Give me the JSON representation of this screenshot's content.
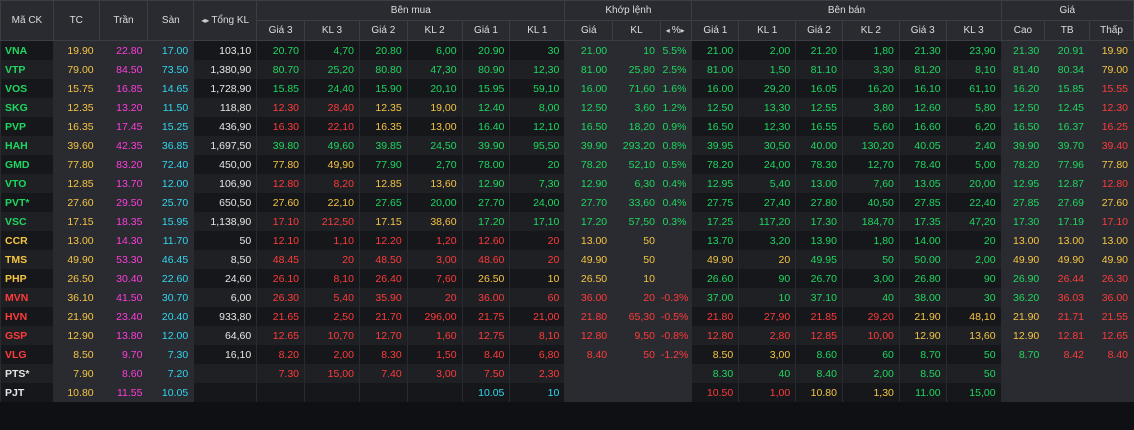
{
  "colors": {
    "green": "#1ed760",
    "red": "#ff3b3b",
    "yellow": "#f5c542",
    "purple": "#ff3ddb",
    "cyan": "#2ed8ef",
    "white": "#e6e6e6"
  },
  "header": {
    "ma_ck": "Mã CK",
    "tc": "TC",
    "tran": "Trần",
    "san": "Sàn",
    "tong_kl": "Tổng KL",
    "ben_mua": "Bên mua",
    "khop_lenh": "Khớp lệnh",
    "ben_ban": "Bên bán",
    "gia": "Giá",
    "gia3": "Giá 3",
    "kl3": "KL 3",
    "gia2": "Giá 2",
    "kl2": "KL 2",
    "gia1": "Giá 1",
    "kl1": "KL 1",
    "khop_gia": "Giá",
    "khop_kl": "KL",
    "khop_pct": "%",
    "cao": "Cao",
    "tb": "TB",
    "thap": "Thấp"
  },
  "rows": [
    {
      "sym": "VNA",
      "sc": "g",
      "tc": "19.90",
      "tran": "22.80",
      "san": "17.00",
      "tkl": "103,10",
      "b3": "20.70",
      "b3c": "g",
      "bk3": "4,70",
      "b2": "20.80",
      "b2c": "g",
      "bk2": "6,00",
      "b1": "20.90",
      "b1c": "g",
      "bk1": "30",
      "mp": "21.00",
      "mc": "g",
      "mk": "10",
      "pct": "5.5%",
      "s1": "21.00",
      "s1c": "g",
      "sk1": "2,00",
      "s2": "21.20",
      "s2c": "g",
      "sk2": "1,80",
      "s3": "21.30",
      "s3c": "g",
      "sk3": "23,90",
      "hi": "21.30",
      "hic": "g",
      "avg": "20.91",
      "avgc": "g",
      "lo": "19.90",
      "loc": "y"
    },
    {
      "sym": "VTP",
      "sc": "g",
      "tc": "79.00",
      "tran": "84.50",
      "san": "73.50",
      "tkl": "1,380,90",
      "b3": "80.70",
      "b3c": "g",
      "bk3": "25,20",
      "b2": "80.80",
      "b2c": "g",
      "bk2": "47,30",
      "b1": "80.90",
      "b1c": "g",
      "bk1": "12,30",
      "mp": "81.00",
      "mc": "g",
      "mk": "25,80",
      "pct": "2.5%",
      "s1": "81.00",
      "s1c": "g",
      "sk1": "1,50",
      "s2": "81.10",
      "s2c": "g",
      "sk2": "3,30",
      "s3": "81.20",
      "s3c": "g",
      "sk3": "8,10",
      "hi": "81.40",
      "hic": "g",
      "avg": "80.34",
      "avgc": "g",
      "lo": "79.00",
      "loc": "y"
    },
    {
      "sym": "VOS",
      "sc": "g",
      "tc": "15.75",
      "tran": "16.85",
      "san": "14.65",
      "tkl": "1,728,90",
      "b3": "15.85",
      "b3c": "g",
      "bk3": "24,40",
      "b2": "15.90",
      "b2c": "g",
      "bk2": "20,10",
      "b1": "15.95",
      "b1c": "g",
      "bk1": "59,10",
      "mp": "16.00",
      "mc": "g",
      "mk": "71,60",
      "pct": "1.6%",
      "s1": "16.00",
      "s1c": "g",
      "sk1": "29,20",
      "s2": "16.05",
      "s2c": "g",
      "sk2": "16,20",
      "s3": "16.10",
      "s3c": "g",
      "sk3": "61,10",
      "hi": "16.20",
      "hic": "g",
      "avg": "15.85",
      "avgc": "g",
      "lo": "15.55",
      "loc": "r"
    },
    {
      "sym": "SKG",
      "sc": "g",
      "tc": "12.35",
      "tran": "13.20",
      "san": "11.50",
      "tkl": "118,80",
      "b3": "12.30",
      "b3c": "r",
      "bk3": "28,40",
      "b2": "12.35",
      "b2c": "y",
      "bk2": "19,00",
      "b1": "12.40",
      "b1c": "g",
      "bk1": "8,00",
      "mp": "12.50",
      "mc": "g",
      "mk": "3,60",
      "pct": "1.2%",
      "s1": "12.50",
      "s1c": "g",
      "sk1": "13,30",
      "s2": "12.55",
      "s2c": "g",
      "sk2": "3,80",
      "s3": "12.60",
      "s3c": "g",
      "sk3": "5,80",
      "hi": "12.50",
      "hic": "g",
      "avg": "12.45",
      "avgc": "g",
      "lo": "12.30",
      "loc": "r"
    },
    {
      "sym": "PVP",
      "sc": "g",
      "tc": "16.35",
      "tran": "17.45",
      "san": "15.25",
      "tkl": "436,90",
      "b3": "16.30",
      "b3c": "r",
      "bk3": "22,10",
      "b2": "16.35",
      "b2c": "y",
      "bk2": "13,00",
      "b1": "16.40",
      "b1c": "g",
      "bk1": "12,10",
      "mp": "16.50",
      "mc": "g",
      "mk": "18,20",
      "pct": "0.9%",
      "s1": "16.50",
      "s1c": "g",
      "sk1": "12,30",
      "s2": "16.55",
      "s2c": "g",
      "sk2": "5,60",
      "s3": "16.60",
      "s3c": "g",
      "sk3": "6,20",
      "hi": "16.50",
      "hic": "g",
      "avg": "16.37",
      "avgc": "g",
      "lo": "16.25",
      "loc": "r"
    },
    {
      "sym": "HAH",
      "sc": "g",
      "tc": "39.60",
      "tran": "42.35",
      "san": "36.85",
      "tkl": "1,697,50",
      "b3": "39.80",
      "b3c": "g",
      "bk3": "49,60",
      "b2": "39.85",
      "b2c": "g",
      "bk2": "24,50",
      "b1": "39.90",
      "b1c": "g",
      "bk1": "95,50",
      "mp": "39.90",
      "mc": "g",
      "mk": "293,20",
      "pct": "0.8%",
      "s1": "39.95",
      "s1c": "g",
      "sk1": "30,50",
      "s2": "40.00",
      "s2c": "g",
      "sk2": "130,20",
      "s3": "40.05",
      "s3c": "g",
      "sk3": "2,40",
      "hi": "39.90",
      "hic": "g",
      "avg": "39.70",
      "avgc": "g",
      "lo": "39.40",
      "loc": "r"
    },
    {
      "sym": "GMD",
      "sc": "g",
      "tc": "77.80",
      "tran": "83.20",
      "san": "72.40",
      "tkl": "450,00",
      "b3": "77.80",
      "b3c": "y",
      "bk3": "49,90",
      "b2": "77.90",
      "b2c": "g",
      "bk2": "2,70",
      "b1": "78.00",
      "b1c": "g",
      "bk1": "20",
      "mp": "78.20",
      "mc": "g",
      "mk": "52,10",
      "pct": "0.5%",
      "s1": "78.20",
      "s1c": "g",
      "sk1": "24,00",
      "s2": "78.30",
      "s2c": "g",
      "sk2": "12,70",
      "s3": "78.40",
      "s3c": "g",
      "sk3": "5,00",
      "hi": "78.20",
      "hic": "g",
      "avg": "77.96",
      "avgc": "g",
      "lo": "77.80",
      "loc": "y"
    },
    {
      "sym": "VTO",
      "sc": "g",
      "tc": "12.85",
      "tran": "13.70",
      "san": "12.00",
      "tkl": "106,90",
      "b3": "12.80",
      "b3c": "r",
      "bk3": "8,20",
      "b2": "12.85",
      "b2c": "y",
      "bk2": "13,60",
      "b1": "12.90",
      "b1c": "g",
      "bk1": "7,30",
      "mp": "12.90",
      "mc": "g",
      "mk": "6,30",
      "pct": "0.4%",
      "s1": "12.95",
      "s1c": "g",
      "sk1": "5,40",
      "s2": "13.00",
      "s2c": "g",
      "sk2": "7,60",
      "s3": "13.05",
      "s3c": "g",
      "sk3": "20,00",
      "hi": "12.95",
      "hic": "g",
      "avg": "12.87",
      "avgc": "g",
      "lo": "12.80",
      "loc": "r"
    },
    {
      "sym": "PVT*",
      "sc": "g",
      "tc": "27.60",
      "tran": "29.50",
      "san": "25.70",
      "tkl": "650,50",
      "b3": "27.60",
      "b3c": "y",
      "bk3": "22,10",
      "b2": "27.65",
      "b2c": "g",
      "bk2": "20,00",
      "b1": "27.70",
      "b1c": "g",
      "bk1": "24,00",
      "mp": "27.70",
      "mc": "g",
      "mk": "33,60",
      "pct": "0.4%",
      "s1": "27.75",
      "s1c": "g",
      "sk1": "27,40",
      "s2": "27.80",
      "s2c": "g",
      "sk2": "40,50",
      "s3": "27.85",
      "s3c": "g",
      "sk3": "22,40",
      "hi": "27.85",
      "hic": "g",
      "avg": "27.69",
      "avgc": "g",
      "lo": "27.60",
      "loc": "y"
    },
    {
      "sym": "VSC",
      "sc": "g",
      "tc": "17.15",
      "tran": "18.35",
      "san": "15.95",
      "tkl": "1,138,90",
      "b3": "17.10",
      "b3c": "r",
      "bk3": "212,50",
      "b2": "17.15",
      "b2c": "y",
      "bk2": "38,60",
      "b1": "17.20",
      "b1c": "g",
      "bk1": "17,10",
      "mp": "17.20",
      "mc": "g",
      "mk": "57,50",
      "pct": "0.3%",
      "s1": "17.25",
      "s1c": "g",
      "sk1": "117,20",
      "s2": "17.30",
      "s2c": "g",
      "sk2": "184,70",
      "s3": "17.35",
      "s3c": "g",
      "sk3": "47,20",
      "hi": "17.30",
      "hic": "g",
      "avg": "17.19",
      "avgc": "g",
      "lo": "17.10",
      "loc": "r"
    },
    {
      "sym": "CCR",
      "sc": "y",
      "tc": "13.00",
      "tran": "14.30",
      "san": "11.70",
      "tkl": "50",
      "b3": "12.10",
      "b3c": "r",
      "bk3": "1,10",
      "b2": "12.20",
      "b2c": "r",
      "bk2": "1,20",
      "b1": "12.60",
      "b1c": "r",
      "bk1": "20",
      "mp": "13.00",
      "mc": "y",
      "mk": "50",
      "pct": "",
      "s1": "13.70",
      "s1c": "g",
      "sk1": "3,20",
      "s2": "13.90",
      "s2c": "g",
      "sk2": "1,80",
      "s3": "14.00",
      "s3c": "g",
      "sk3": "20",
      "hi": "13.00",
      "hic": "y",
      "avg": "13.00",
      "avgc": "y",
      "lo": "13.00",
      "loc": "y"
    },
    {
      "sym": "TMS",
      "sc": "y",
      "tc": "49.90",
      "tran": "53.30",
      "san": "46.45",
      "tkl": "8,50",
      "b3": "48.45",
      "b3c": "r",
      "bk3": "20",
      "b2": "48.50",
      "b2c": "r",
      "bk2": "3,00",
      "b1": "48.60",
      "b1c": "r",
      "bk1": "20",
      "mp": "49.90",
      "mc": "y",
      "mk": "50",
      "pct": "",
      "s1": "49.90",
      "s1c": "y",
      "sk1": "20",
      "s2": "49.95",
      "s2c": "g",
      "sk2": "50",
      "s3": "50.00",
      "s3c": "g",
      "sk3": "2,00",
      "hi": "49.90",
      "hic": "y",
      "avg": "49.90",
      "avgc": "y",
      "lo": "49.90",
      "loc": "y"
    },
    {
      "sym": "PHP",
      "sc": "y",
      "tc": "26.50",
      "tran": "30.40",
      "san": "22.60",
      "tkl": "24,60",
      "b3": "26.10",
      "b3c": "r",
      "bk3": "8,10",
      "b2": "26.40",
      "b2c": "r",
      "bk2": "7,60",
      "b1": "26.50",
      "b1c": "y",
      "bk1": "10",
      "mp": "26.50",
      "mc": "y",
      "mk": "10",
      "pct": "",
      "s1": "26.60",
      "s1c": "g",
      "sk1": "90",
      "s2": "26.70",
      "s2c": "g",
      "sk2": "3,00",
      "s3": "26.80",
      "s3c": "g",
      "sk3": "90",
      "hi": "26.90",
      "hic": "g",
      "avg": "26.44",
      "avgc": "r",
      "lo": "26.30",
      "loc": "r"
    },
    {
      "sym": "MVN",
      "sc": "r",
      "tc": "36.10",
      "tran": "41.50",
      "san": "30.70",
      "tkl": "6,00",
      "b3": "26.30",
      "b3c": "r",
      "bk3": "5,40",
      "b2": "35.90",
      "b2c": "r",
      "bk2": "20",
      "b1": "36.00",
      "b1c": "r",
      "bk1": "60",
      "mp": "36.00",
      "mc": "r",
      "mk": "20",
      "pct": "-0.3%",
      "s1": "37.00",
      "s1c": "g",
      "sk1": "10",
      "s2": "37.10",
      "s2c": "g",
      "sk2": "40",
      "s3": "38.00",
      "s3c": "g",
      "sk3": "30",
      "hi": "36.20",
      "hic": "g",
      "avg": "36.03",
      "avgc": "r",
      "lo": "36.00",
      "loc": "r"
    },
    {
      "sym": "HVN",
      "sc": "r",
      "tc": "21.90",
      "tran": "23.40",
      "san": "20.40",
      "tkl": "933,80",
      "b3": "21.65",
      "b3c": "r",
      "bk3": "2,50",
      "b2": "21.70",
      "b2c": "r",
      "bk2": "296,00",
      "b1": "21.75",
      "b1c": "r",
      "bk1": "21,00",
      "mp": "21.80",
      "mc": "r",
      "mk": "65,30",
      "pct": "-0.5%",
      "s1": "21.80",
      "s1c": "r",
      "sk1": "27,90",
      "s2": "21.85",
      "s2c": "r",
      "sk2": "29,20",
      "s3": "21.90",
      "s3c": "y",
      "sk3": "48,10",
      "hi": "21.90",
      "hic": "y",
      "avg": "21.71",
      "avgc": "r",
      "lo": "21.55",
      "loc": "r"
    },
    {
      "sym": "GSP",
      "sc": "r",
      "tc": "12.90",
      "tran": "13.80",
      "san": "12.00",
      "tkl": "64,60",
      "b3": "12.65",
      "b3c": "r",
      "bk3": "10,70",
      "b2": "12.70",
      "b2c": "r",
      "bk2": "1,60",
      "b1": "12.75",
      "b1c": "r",
      "bk1": "8,10",
      "mp": "12.80",
      "mc": "r",
      "mk": "9,50",
      "pct": "-0.8%",
      "s1": "12.80",
      "s1c": "r",
      "sk1": "2,80",
      "s2": "12.85",
      "s2c": "r",
      "sk2": "10,00",
      "s3": "12.90",
      "s3c": "y",
      "sk3": "13,60",
      "hi": "12.90",
      "hic": "y",
      "avg": "12.81",
      "avgc": "r",
      "lo": "12.65",
      "loc": "r"
    },
    {
      "sym": "VLG",
      "sc": "r",
      "tc": "8.50",
      "tran": "9.70",
      "san": "7.30",
      "tkl": "16,10",
      "b3": "8.20",
      "b3c": "r",
      "bk3": "2,00",
      "b2": "8.30",
      "b2c": "r",
      "bk2": "1,50",
      "b1": "8.40",
      "b1c": "r",
      "bk1": "6,80",
      "mp": "8.40",
      "mc": "r",
      "mk": "50",
      "pct": "-1.2%",
      "s1": "8.50",
      "s1c": "y",
      "sk1": "3,00",
      "s2": "8.60",
      "s2c": "g",
      "sk2": "60",
      "s3": "8.70",
      "s3c": "g",
      "sk3": "50",
      "hi": "8.70",
      "hic": "g",
      "avg": "8.42",
      "avgc": "r",
      "lo": "8.40",
      "loc": "r"
    },
    {
      "sym": "PTS*",
      "sc": "w",
      "tc": "7.90",
      "tran": "8.60",
      "san": "7.20",
      "tkl": "",
      "b3": "7.30",
      "b3c": "r",
      "bk3": "15,00",
      "b2": "7.40",
      "b2c": "r",
      "bk2": "3,00",
      "b1": "7.50",
      "b1c": "r",
      "bk1": "2,30",
      "mp": "",
      "mc": "w",
      "mk": "",
      "pct": "",
      "s1": "8.30",
      "s1c": "g",
      "sk1": "40",
      "s2": "8.40",
      "s2c": "g",
      "sk2": "2,00",
      "s3": "8.50",
      "s3c": "g",
      "sk3": "50",
      "hi": "",
      "hic": "w",
      "avg": "",
      "avgc": "w",
      "lo": "",
      "loc": "w"
    },
    {
      "sym": "PJT",
      "sc": "w",
      "tc": "10.80",
      "tran": "11.55",
      "san": "10.05",
      "tkl": "",
      "b3": "",
      "b3c": "w",
      "bk3": "",
      "b2": "",
      "b2c": "w",
      "bk2": "",
      "b1": "10.05",
      "b1c": "c",
      "bk1": "10",
      "mp": "",
      "mc": "w",
      "mk": "",
      "pct": "",
      "s1": "10.50",
      "s1c": "r",
      "sk1": "1,00",
      "s2": "10.80",
      "s2c": "y",
      "sk2": "1,30",
      "s3": "11.00",
      "s3c": "g",
      "sk3": "15,00",
      "hi": "",
      "hic": "w",
      "avg": "",
      "avgc": "w",
      "lo": "",
      "loc": "w"
    }
  ]
}
